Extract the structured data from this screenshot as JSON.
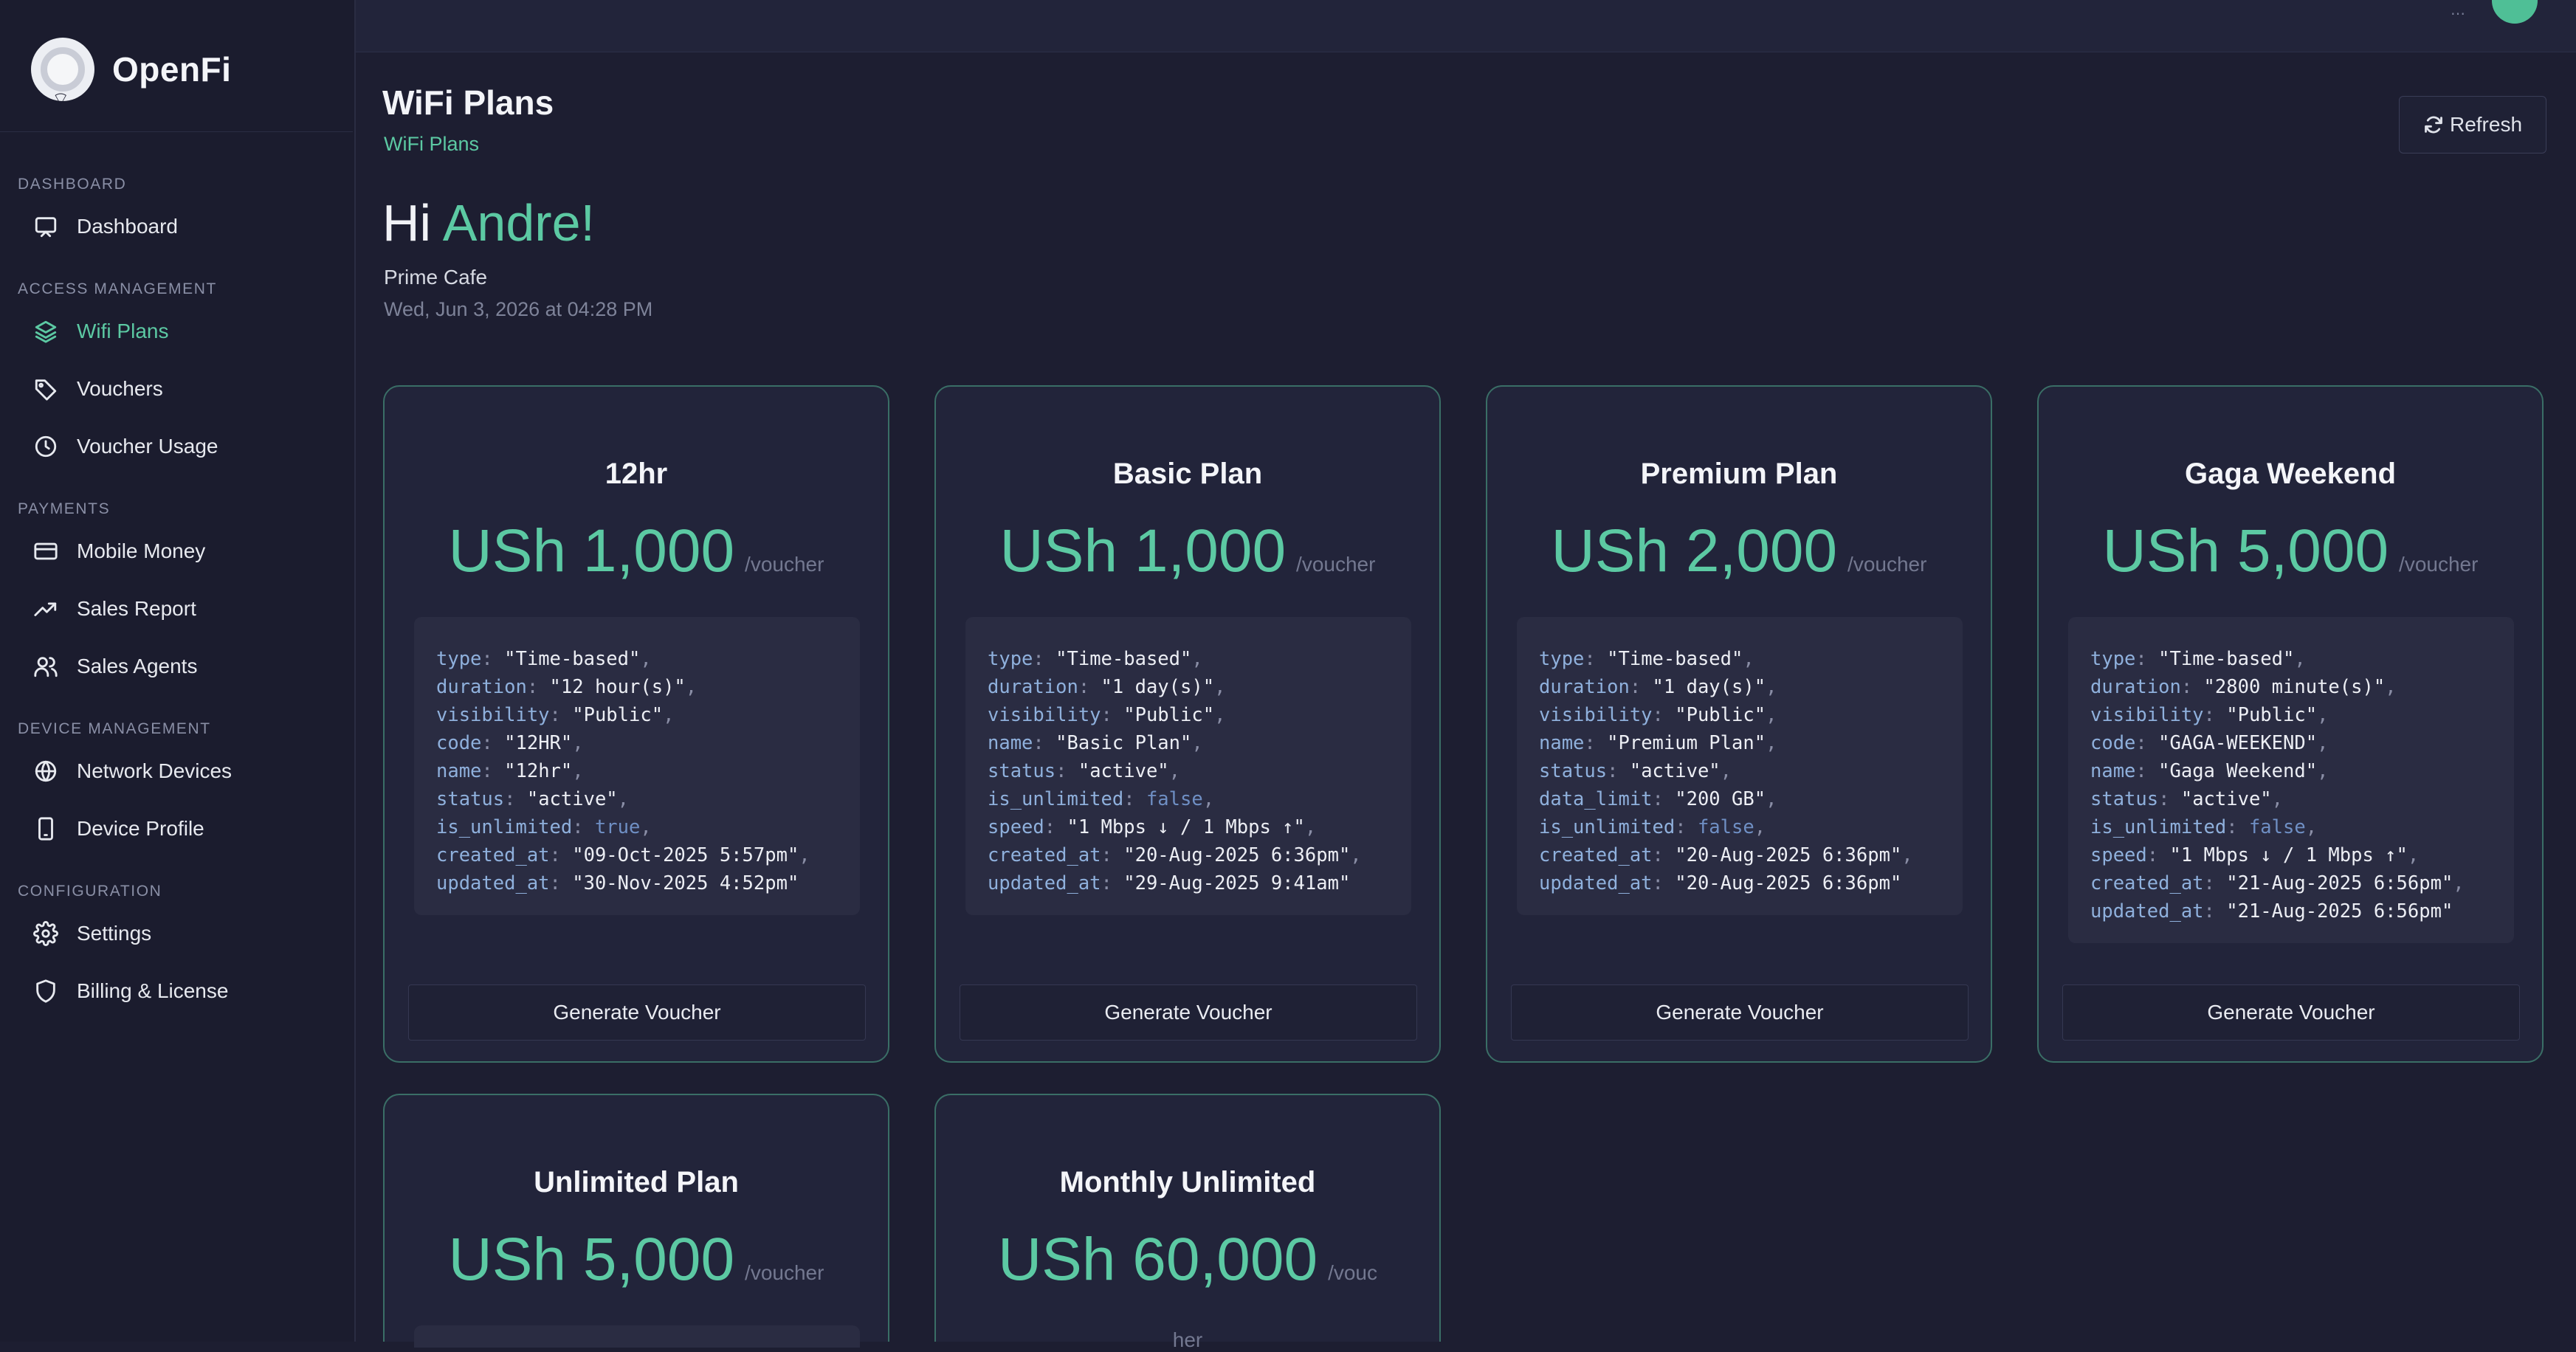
{
  "app": {
    "name": "OpenFi"
  },
  "header": {
    "title": "WiFi Plans",
    "breadcrumb": "WiFi Plans",
    "refresh_label": "Refresh"
  },
  "greeting": {
    "hi": "Hi ",
    "name": "Andre!",
    "venue": "Prime Cafe",
    "datetime": "Wed, Jun 3, 2026 at 04:28 PM"
  },
  "sidebar": {
    "sections": [
      {
        "title": "DASHBOARD"
      },
      {
        "title": "ACCESS MANAGEMENT"
      },
      {
        "title": "PAYMENTS"
      },
      {
        "title": "DEVICE MANAGEMENT"
      },
      {
        "title": "CONFIGURATION"
      }
    ],
    "items": [
      {
        "label": "Dashboard",
        "icon": "monitor-icon"
      },
      {
        "label": "Wifi Plans",
        "icon": "layers-icon",
        "active": true
      },
      {
        "label": "Vouchers",
        "icon": "tag-icon"
      },
      {
        "label": "Voucher Usage",
        "icon": "clock-icon"
      },
      {
        "label": "Mobile Money",
        "icon": "credit-card-icon"
      },
      {
        "label": "Sales Report",
        "icon": "trending-up-icon"
      },
      {
        "label": "Sales Agents",
        "icon": "users-icon"
      },
      {
        "label": "Network Devices",
        "icon": "globe-icon"
      },
      {
        "label": "Device Profile",
        "icon": "smartphone-icon"
      },
      {
        "label": "Settings",
        "icon": "gear-icon"
      },
      {
        "label": "Billing & License",
        "icon": "shield-icon"
      }
    ]
  },
  "plans": [
    {
      "name": "12hr",
      "price": "USh 1,000",
      "per": "/voucher",
      "button": "Generate Voucher",
      "details": [
        {
          "key": "type",
          "value": "\"Time-based\""
        },
        {
          "key": "duration",
          "value": "\"12 hour(s)\""
        },
        {
          "key": "visibility",
          "value": "\"Public\""
        },
        {
          "key": "code",
          "value": "\"12HR\""
        },
        {
          "key": "name",
          "value": "\"12hr\""
        },
        {
          "key": "status",
          "value": "\"active\""
        },
        {
          "key": "is_unlimited",
          "value": "true"
        },
        {
          "key": "created_at",
          "value": "\"09-Oct-2025 5:57pm\""
        },
        {
          "key": "updated_at",
          "value": "\"30-Nov-2025 4:52pm\""
        }
      ]
    },
    {
      "name": "Basic Plan",
      "price": "USh 1,000",
      "per": "/voucher",
      "button": "Generate Voucher",
      "details": [
        {
          "key": "type",
          "value": "\"Time-based\""
        },
        {
          "key": "duration",
          "value": "\"1 day(s)\""
        },
        {
          "key": "visibility",
          "value": "\"Public\""
        },
        {
          "key": "name",
          "value": "\"Basic Plan\""
        },
        {
          "key": "status",
          "value": "\"active\""
        },
        {
          "key": "is_unlimited",
          "value": "false"
        },
        {
          "key": "speed",
          "value": "\"1 Mbps ↓ / 1 Mbps ↑\""
        },
        {
          "key": "created_at",
          "value": "\"20-Aug-2025 6:36pm\""
        },
        {
          "key": "updated_at",
          "value": "\"29-Aug-2025 9:41am\""
        }
      ]
    },
    {
      "name": "Premium Plan",
      "price": "USh 2,000",
      "per": "/voucher",
      "button": "Generate Voucher",
      "details": [
        {
          "key": "type",
          "value": "\"Time-based\""
        },
        {
          "key": "duration",
          "value": "\"1 day(s)\""
        },
        {
          "key": "visibility",
          "value": "\"Public\""
        },
        {
          "key": "name",
          "value": "\"Premium Plan\""
        },
        {
          "key": "status",
          "value": "\"active\""
        },
        {
          "key": "data_limit",
          "value": "\"200 GB\""
        },
        {
          "key": "is_unlimited",
          "value": "false"
        },
        {
          "key": "created_at",
          "value": "\"20-Aug-2025 6:36pm\""
        },
        {
          "key": "updated_at",
          "value": "\"20-Aug-2025 6:36pm\""
        }
      ]
    },
    {
      "name": "Gaga Weekend",
      "price": "USh 5,000",
      "per": "/voucher",
      "button": "Generate Voucher",
      "details": [
        {
          "key": "type",
          "value": "\"Time-based\""
        },
        {
          "key": "duration",
          "value": "\"2800 minute(s)\""
        },
        {
          "key": "visibility",
          "value": "\"Public\""
        },
        {
          "key": "code",
          "value": "\"GAGA-WEEKEND\""
        },
        {
          "key": "name",
          "value": "\"Gaga Weekend\""
        },
        {
          "key": "status",
          "value": "\"active\""
        },
        {
          "key": "is_unlimited",
          "value": "false"
        },
        {
          "key": "speed",
          "value": "\"1 Mbps ↓ / 1 Mbps ↑\""
        },
        {
          "key": "created_at",
          "value": "\"21-Aug-2025 6:56pm\""
        },
        {
          "key": "updated_at",
          "value": "\"21-Aug-2025 6:56pm\""
        }
      ]
    },
    {
      "name": "Unlimited Plan",
      "price": "USh 5,000",
      "per": "/voucher"
    },
    {
      "name": "Monthly Unlimited",
      "price": "USh 60,000",
      "per": "/vouc",
      "per_tail": "her"
    }
  ],
  "colors": {
    "accent": "#5cc9a3",
    "background": "#1d1e31",
    "card_border": "#3a6e66"
  }
}
